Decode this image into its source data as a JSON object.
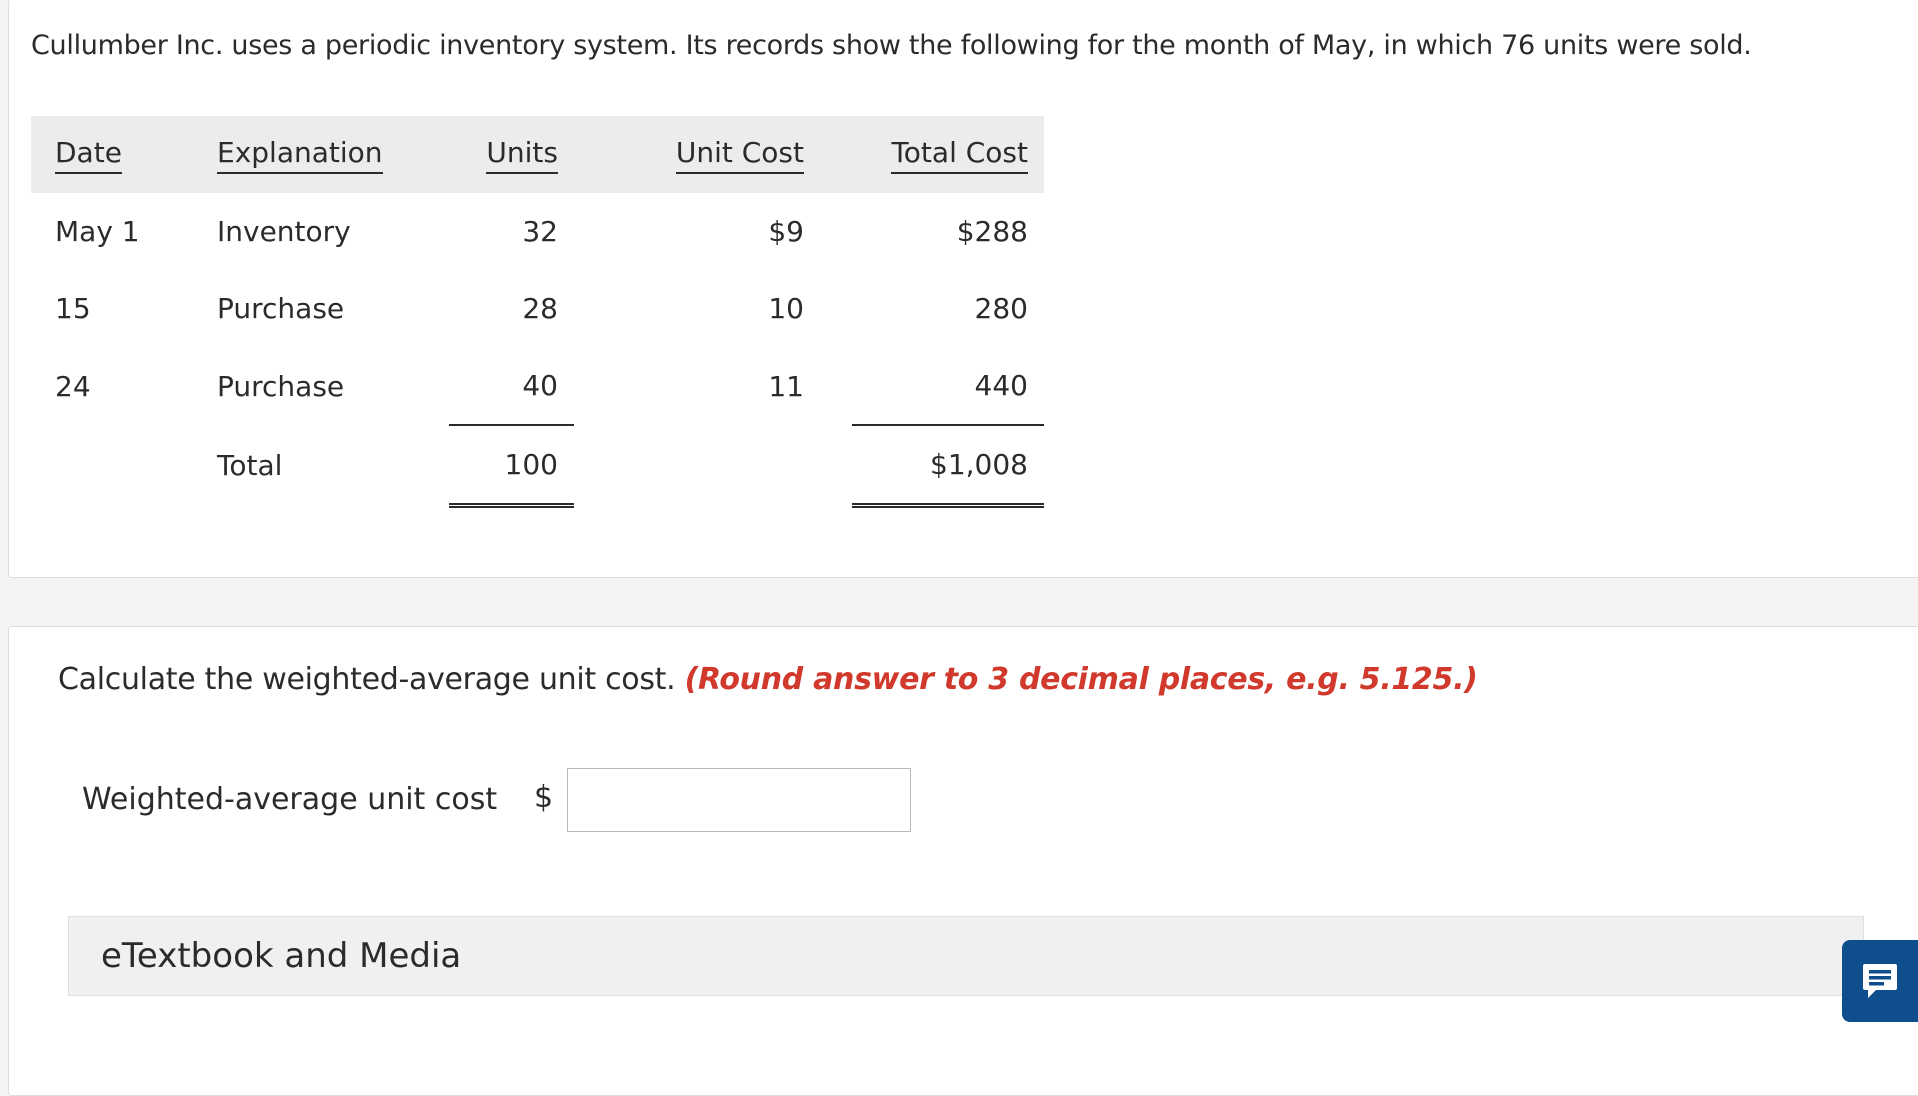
{
  "problem": {
    "intro": "Cullumber Inc. uses a periodic inventory system. Its records show the following for the month of May, in which 76 units were sold.",
    "headers": {
      "date": "Date",
      "explanation": "Explanation",
      "units": "Units",
      "unit_cost": "Unit Cost",
      "total_cost": "Total Cost"
    },
    "rows": [
      {
        "date": "May 1",
        "explanation": "Inventory",
        "units": "32",
        "unit_cost": "$9",
        "total_cost": "$288"
      },
      {
        "date": "15",
        "explanation": "Purchase",
        "units": "28",
        "unit_cost": "10",
        "total_cost": "280"
      },
      {
        "date": "24",
        "explanation": "Purchase",
        "units": "40",
        "unit_cost": "11",
        "total_cost": "440"
      }
    ],
    "total": {
      "label": "Total",
      "units": "100",
      "total_cost": "$1,008"
    }
  },
  "question": {
    "text": "Calculate the weighted-average unit cost.",
    "hint": "(Round answer to 3 decimal places, e.g. 5.125.)",
    "answer_label": "Weighted-average unit cost",
    "currency_symbol": "$",
    "answer_value": "",
    "hint_color": "#d0392b"
  },
  "etextbook": {
    "label": "eTextbook and Media"
  },
  "feedback": {
    "icon": "message-icon",
    "color": "#0f4e8c"
  }
}
